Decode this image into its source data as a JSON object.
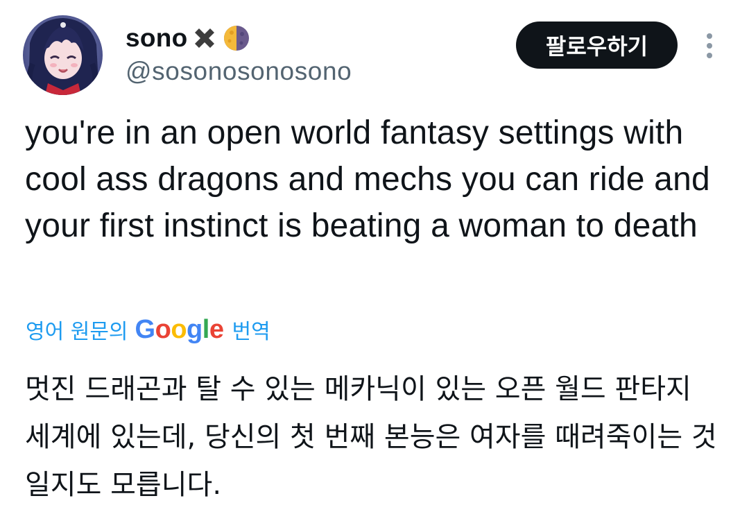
{
  "user": {
    "display_name": "sono",
    "name_emojis": [
      "cross-mark-icon",
      "moon-phase-icon"
    ],
    "handle": "@sosonosonosono",
    "avatar": "anime-character-avatar"
  },
  "actions": {
    "follow_label": "팔로우하기",
    "more_icon": "more-vertical-icon"
  },
  "tweet": {
    "text": "you're in an open world fantasy settings with cool ass dragons and mechs you can ride and your first instinct is beating a woman to death"
  },
  "translation": {
    "prefix": "영어 원문의",
    "provider_letters": [
      "G",
      "o",
      "o",
      "g",
      "l",
      "e"
    ],
    "suffix": "번역",
    "text": "멋진 드래곤과 탈 수 있는 메카닉이 있는 오픈 월드 판타지 세계에 있는데, 당신의 첫 번째 본능은 여자를 때려죽이는 것일지도 모릅니다."
  },
  "colors": {
    "link": "#1d9bf0",
    "text": "#0f1419",
    "secondary": "#536471",
    "button_bg": "#0f1419",
    "google_blue": "#4285f4",
    "google_red": "#ea4335",
    "google_yellow": "#fbbc05",
    "google_green": "#34a853"
  }
}
